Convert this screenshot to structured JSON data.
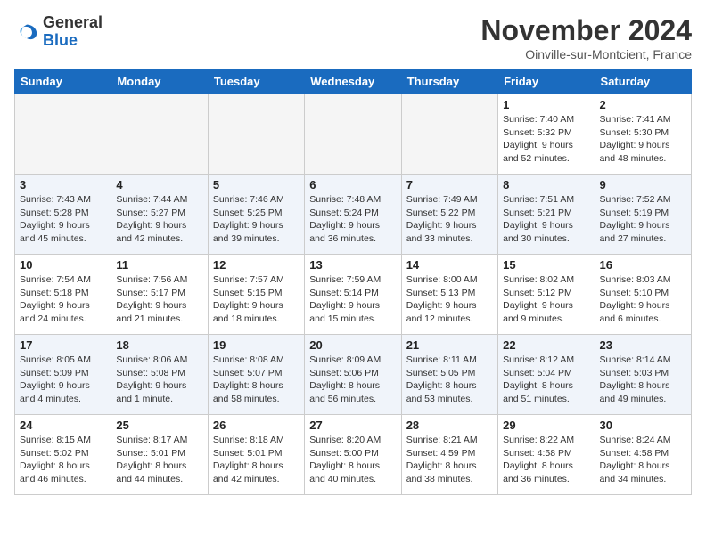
{
  "header": {
    "logo_general": "General",
    "logo_blue": "Blue",
    "month_title": "November 2024",
    "subtitle": "Oinville-sur-Montcient, France"
  },
  "weekdays": [
    "Sunday",
    "Monday",
    "Tuesday",
    "Wednesday",
    "Thursday",
    "Friday",
    "Saturday"
  ],
  "weeks": [
    [
      {
        "day": "",
        "info": ""
      },
      {
        "day": "",
        "info": ""
      },
      {
        "day": "",
        "info": ""
      },
      {
        "day": "",
        "info": ""
      },
      {
        "day": "",
        "info": ""
      },
      {
        "day": "1",
        "info": "Sunrise: 7:40 AM\nSunset: 5:32 PM\nDaylight: 9 hours and 52 minutes."
      },
      {
        "day": "2",
        "info": "Sunrise: 7:41 AM\nSunset: 5:30 PM\nDaylight: 9 hours and 48 minutes."
      }
    ],
    [
      {
        "day": "3",
        "info": "Sunrise: 7:43 AM\nSunset: 5:28 PM\nDaylight: 9 hours and 45 minutes."
      },
      {
        "day": "4",
        "info": "Sunrise: 7:44 AM\nSunset: 5:27 PM\nDaylight: 9 hours and 42 minutes."
      },
      {
        "day": "5",
        "info": "Sunrise: 7:46 AM\nSunset: 5:25 PM\nDaylight: 9 hours and 39 minutes."
      },
      {
        "day": "6",
        "info": "Sunrise: 7:48 AM\nSunset: 5:24 PM\nDaylight: 9 hours and 36 minutes."
      },
      {
        "day": "7",
        "info": "Sunrise: 7:49 AM\nSunset: 5:22 PM\nDaylight: 9 hours and 33 minutes."
      },
      {
        "day": "8",
        "info": "Sunrise: 7:51 AM\nSunset: 5:21 PM\nDaylight: 9 hours and 30 minutes."
      },
      {
        "day": "9",
        "info": "Sunrise: 7:52 AM\nSunset: 5:19 PM\nDaylight: 9 hours and 27 minutes."
      }
    ],
    [
      {
        "day": "10",
        "info": "Sunrise: 7:54 AM\nSunset: 5:18 PM\nDaylight: 9 hours and 24 minutes."
      },
      {
        "day": "11",
        "info": "Sunrise: 7:56 AM\nSunset: 5:17 PM\nDaylight: 9 hours and 21 minutes."
      },
      {
        "day": "12",
        "info": "Sunrise: 7:57 AM\nSunset: 5:15 PM\nDaylight: 9 hours and 18 minutes."
      },
      {
        "day": "13",
        "info": "Sunrise: 7:59 AM\nSunset: 5:14 PM\nDaylight: 9 hours and 15 minutes."
      },
      {
        "day": "14",
        "info": "Sunrise: 8:00 AM\nSunset: 5:13 PM\nDaylight: 9 hours and 12 minutes."
      },
      {
        "day": "15",
        "info": "Sunrise: 8:02 AM\nSunset: 5:12 PM\nDaylight: 9 hours and 9 minutes."
      },
      {
        "day": "16",
        "info": "Sunrise: 8:03 AM\nSunset: 5:10 PM\nDaylight: 9 hours and 6 minutes."
      }
    ],
    [
      {
        "day": "17",
        "info": "Sunrise: 8:05 AM\nSunset: 5:09 PM\nDaylight: 9 hours and 4 minutes."
      },
      {
        "day": "18",
        "info": "Sunrise: 8:06 AM\nSunset: 5:08 PM\nDaylight: 9 hours and 1 minute."
      },
      {
        "day": "19",
        "info": "Sunrise: 8:08 AM\nSunset: 5:07 PM\nDaylight: 8 hours and 58 minutes."
      },
      {
        "day": "20",
        "info": "Sunrise: 8:09 AM\nSunset: 5:06 PM\nDaylight: 8 hours and 56 minutes."
      },
      {
        "day": "21",
        "info": "Sunrise: 8:11 AM\nSunset: 5:05 PM\nDaylight: 8 hours and 53 minutes."
      },
      {
        "day": "22",
        "info": "Sunrise: 8:12 AM\nSunset: 5:04 PM\nDaylight: 8 hours and 51 minutes."
      },
      {
        "day": "23",
        "info": "Sunrise: 8:14 AM\nSunset: 5:03 PM\nDaylight: 8 hours and 49 minutes."
      }
    ],
    [
      {
        "day": "24",
        "info": "Sunrise: 8:15 AM\nSunset: 5:02 PM\nDaylight: 8 hours and 46 minutes."
      },
      {
        "day": "25",
        "info": "Sunrise: 8:17 AM\nSunset: 5:01 PM\nDaylight: 8 hours and 44 minutes."
      },
      {
        "day": "26",
        "info": "Sunrise: 8:18 AM\nSunset: 5:01 PM\nDaylight: 8 hours and 42 minutes."
      },
      {
        "day": "27",
        "info": "Sunrise: 8:20 AM\nSunset: 5:00 PM\nDaylight: 8 hours and 40 minutes."
      },
      {
        "day": "28",
        "info": "Sunrise: 8:21 AM\nSunset: 4:59 PM\nDaylight: 8 hours and 38 minutes."
      },
      {
        "day": "29",
        "info": "Sunrise: 8:22 AM\nSunset: 4:58 PM\nDaylight: 8 hours and 36 minutes."
      },
      {
        "day": "30",
        "info": "Sunrise: 8:24 AM\nSunset: 4:58 PM\nDaylight: 8 hours and 34 minutes."
      }
    ]
  ]
}
